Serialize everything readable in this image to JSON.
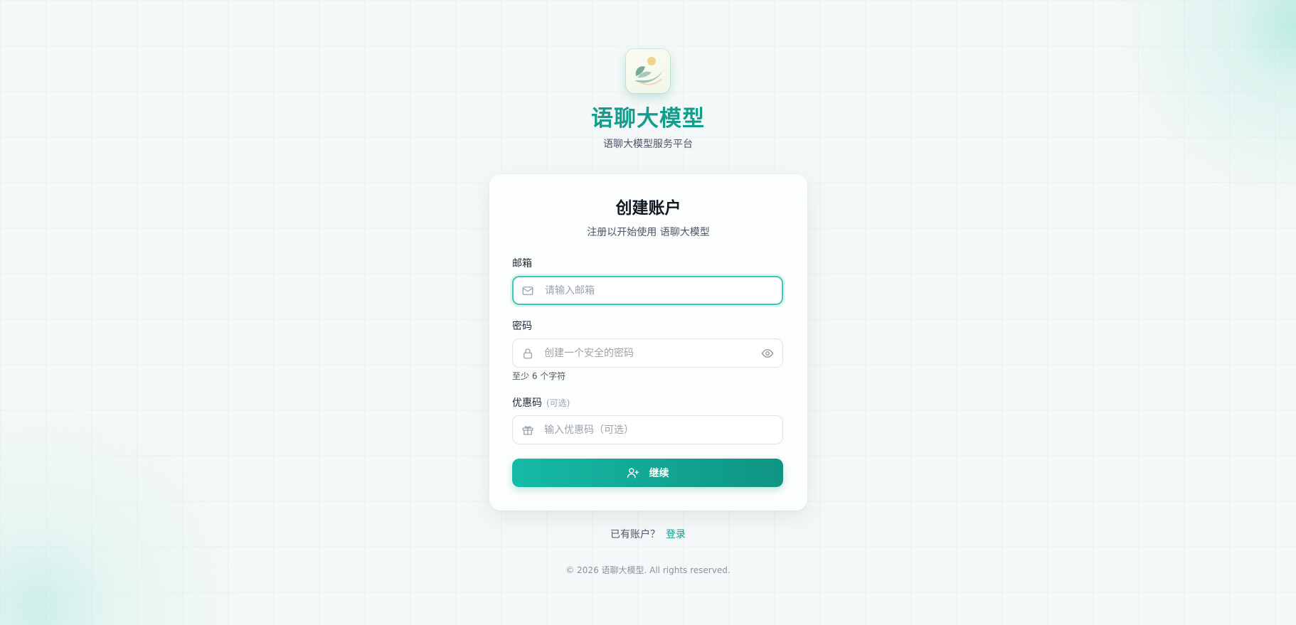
{
  "brand": {
    "title": "语聊大模型",
    "subtitle": "语聊大模型服务平台"
  },
  "card": {
    "title": "创建账户",
    "subtitle": "注册以开始使用 语聊大模型"
  },
  "form": {
    "email": {
      "label": "邮箱",
      "placeholder": "请输入邮箱",
      "icon": "mail-icon"
    },
    "password": {
      "label": "密码",
      "placeholder": "创建一个安全的密码",
      "hint": "至少 6 个字符",
      "icon": "lock-icon",
      "toggle_icon": "eye-icon"
    },
    "coupon": {
      "label": "优惠码",
      "optional_tag": "(可选)",
      "placeholder": "输入优惠码（可选）",
      "icon": "gift-icon"
    },
    "submit": {
      "label": "继续",
      "icon": "user-plus-icon"
    }
  },
  "login_prompt": {
    "text": "已有账户？",
    "link": "登录"
  },
  "footer": {
    "text": "© 2026 语聊大模型. All rights reserved."
  },
  "colors": {
    "accent": "#129d8d",
    "focus_border": "#3ccab6",
    "button_start": "#15bba6",
    "button_end": "#0f9483"
  }
}
